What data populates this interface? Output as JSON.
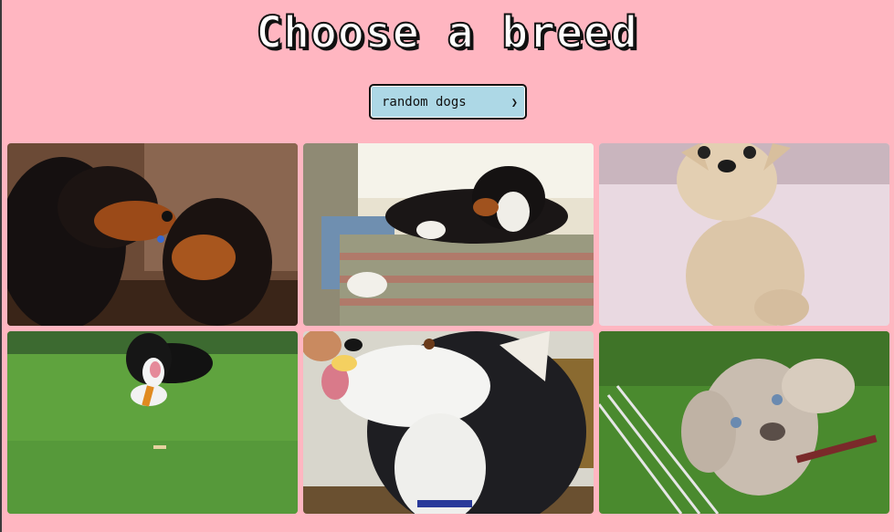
{
  "title": "Choose a breed",
  "breed_select": {
    "selected": "random dogs"
  },
  "gallery": {
    "photos": [
      {
        "icon": "dog-photo",
        "subject": "gordon-setters"
      },
      {
        "icon": "dog-photo",
        "subject": "bernese-mountain-dog"
      },
      {
        "icon": "dog-photo",
        "subject": "chihuahua"
      },
      {
        "icon": "dog-photo",
        "subject": "dog-in-grass"
      },
      {
        "icon": "dog-photo",
        "subject": "husky"
      },
      {
        "icon": "dog-photo",
        "subject": "weimaraner-puppy"
      }
    ]
  }
}
